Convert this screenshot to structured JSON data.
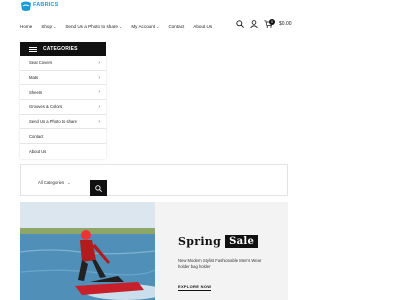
{
  "brand": {
    "name": "FABRICS",
    "color": "#1a9ad6"
  },
  "nav": {
    "items": [
      {
        "label": "Home",
        "has_dropdown": false
      },
      {
        "label": "Shop",
        "has_dropdown": true
      },
      {
        "label": "Send Us a Photo to share",
        "has_dropdown": true
      },
      {
        "label": "My Account",
        "has_dropdown": true
      },
      {
        "label": "Contact",
        "has_dropdown": false
      },
      {
        "label": "About Us",
        "has_dropdown": false
      }
    ]
  },
  "header": {
    "cart_count": "0",
    "cart_total": "$0.00",
    "icons": [
      "search-icon",
      "user-icon",
      "cart-icon"
    ]
  },
  "categories": {
    "title": "CATEGORIES",
    "items": [
      {
        "label": "Seat Covers",
        "has_submenu": true
      },
      {
        "label": "Mats",
        "has_submenu": true
      },
      {
        "label": "Sheets",
        "has_submenu": true
      },
      {
        "label": "Grooves & Colors",
        "has_submenu": true
      },
      {
        "label": "Send Us a Photo to share",
        "has_submenu": true
      },
      {
        "label": "Contact",
        "has_submenu": false
      },
      {
        "label": "About Us",
        "has_submenu": false
      }
    ]
  },
  "search": {
    "category_selected": "All Categories"
  },
  "banner": {
    "title_word": "Spring",
    "title_highlight": "Sale",
    "description": "New Modern Stylist Fashionable Men's Wear holder bag holder",
    "cta_label": "EXPLORE NOW"
  }
}
